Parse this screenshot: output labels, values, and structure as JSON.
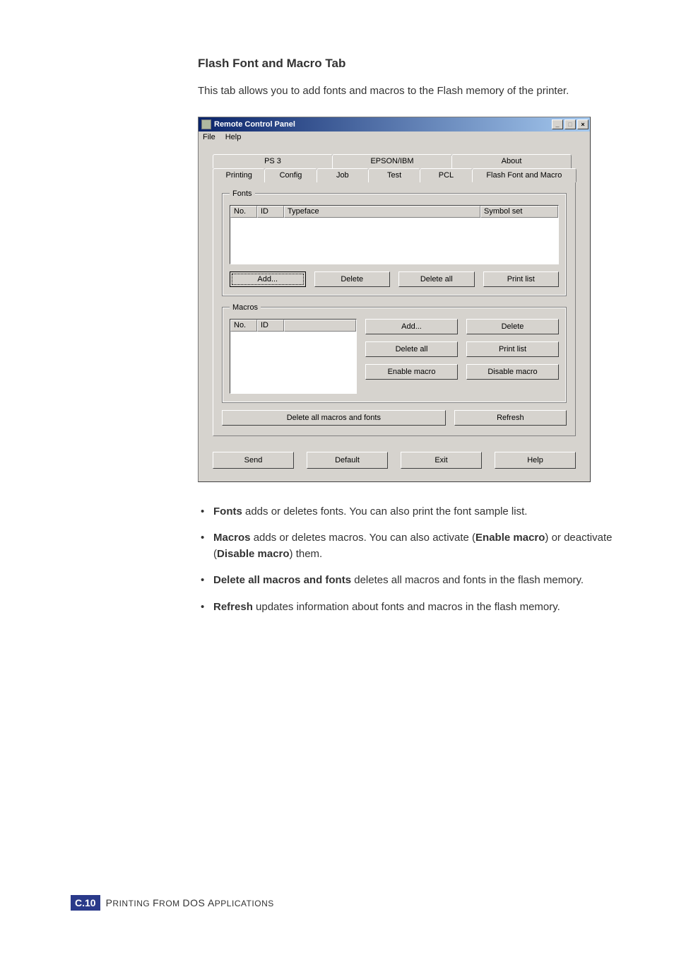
{
  "heading": "Flash Font and Macro Tab",
  "intro": "This tab allows you to add fonts and macros to the Flash memory of the printer.",
  "window": {
    "title": "Remote Control Panel",
    "controls": {
      "min": "_",
      "max": "□",
      "close": "×"
    },
    "menu": {
      "file": "File",
      "help": "Help"
    },
    "tabsTop": {
      "ps3": "PS 3",
      "epson": "EPSON/IBM",
      "about": "About"
    },
    "tabsBottom": {
      "printing": "Printing",
      "config": "Config",
      "job": "Job",
      "test": "Test",
      "pcl": "PCL",
      "flash": "Flash Font and Macro"
    },
    "fonts": {
      "legend": "Fonts",
      "cols": {
        "no": "No.",
        "id": "ID",
        "typeface": "Typeface",
        "symbolset": "Symbol set"
      },
      "add": "Add...",
      "delete": "Delete",
      "deleteAll": "Delete all",
      "printList": "Print list"
    },
    "macros": {
      "legend": "Macros",
      "cols": {
        "no": "No.",
        "id": "ID"
      },
      "add": "Add...",
      "delete": "Delete",
      "deleteAll": "Delete all",
      "printList": "Print list",
      "enable": "Enable macro",
      "disable": "Disable macro"
    },
    "deleteAllMacrosFonts": "Delete all macros and fonts",
    "refresh": "Refresh",
    "footer": {
      "send": "Send",
      "default": "Default",
      "exit": "Exit",
      "help": "Help"
    }
  },
  "bullets": {
    "b1": {
      "bold": "Fonts",
      "text": " adds or deletes fonts. You can also print the font sample list."
    },
    "b2": {
      "bold1": "Macros",
      "text1": " adds or deletes macros. You can also activate (",
      "bold2": "Enable macro",
      "text2": ") or deactivate (",
      "bold3": "Disable macro",
      "text3": ") them."
    },
    "b3": {
      "bold": "Delete all macros and fonts",
      "text": " deletes all macros and fonts in the flash memory."
    },
    "b4": {
      "bold": "Refresh",
      "text": " updates information about fonts and macros in the flash memory."
    }
  },
  "footer": {
    "badgeC": "C.",
    "badgeN": "10",
    "textA": "P",
    "textB": "RINTING ",
    "textC": "F",
    "textD": "ROM ",
    "textE": "DOS A",
    "textF": "PPLICATIONS"
  }
}
